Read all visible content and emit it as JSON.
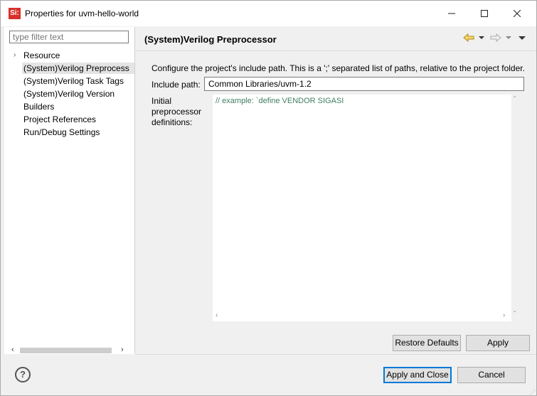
{
  "window": {
    "app_icon_text": "Si:",
    "title": "Properties for uvm-hello-world"
  },
  "left_pane": {
    "filter_placeholder": "type filter text",
    "tree_items": [
      {
        "label": "Resource",
        "expandable": true
      },
      {
        "label": "(System)Verilog Preprocess",
        "selected": true
      },
      {
        "label": "(System)Verilog Task Tags"
      },
      {
        "label": "(System)Verilog Version"
      },
      {
        "label": "Builders"
      },
      {
        "label": "Project References"
      },
      {
        "label": "Run/Debug Settings"
      }
    ]
  },
  "page": {
    "title": "(System)Verilog Preprocessor",
    "description": "Configure the project's include path. This is a ';' separated list of paths, relative to the project folder.",
    "include_path_label": "Include path:",
    "include_path_value": "Common Libraries/uvm-1.2",
    "definitions_label_1": "Initial",
    "definitions_label_2": "preprocessor",
    "definitions_label_3": "definitions:",
    "definitions_text": "// example: `define VENDOR SIGASI",
    "restore_defaults": "Restore Defaults",
    "apply": "Apply"
  },
  "footer": {
    "apply_close": "Apply and Close",
    "cancel": "Cancel",
    "help": "?"
  },
  "colors": {
    "accent": "#0078d7",
    "comment": "#3f7f5f",
    "app_icon": "#d9302a"
  }
}
